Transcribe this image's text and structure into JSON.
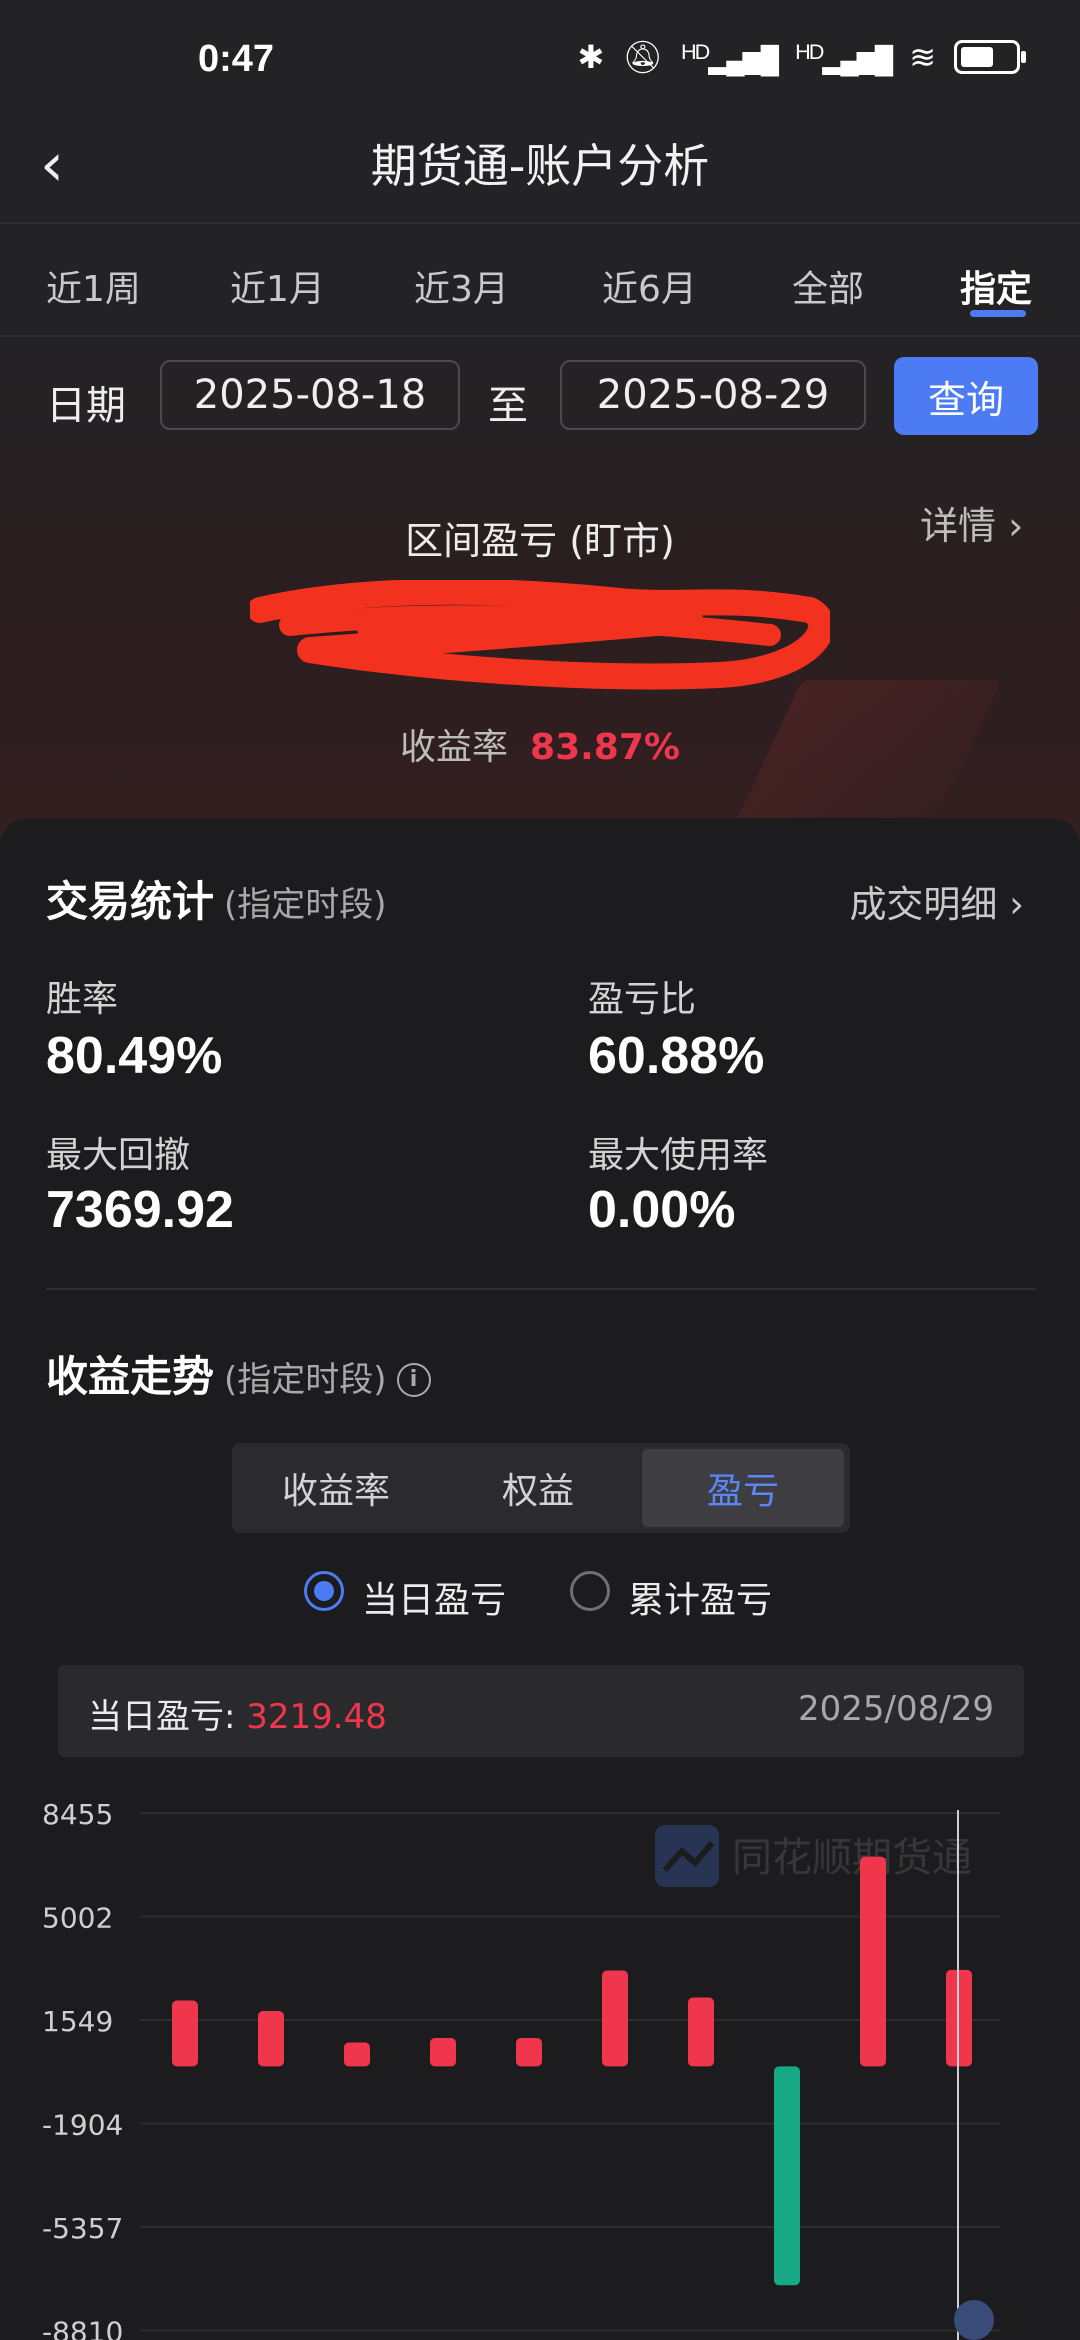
{
  "status_bar": {
    "time": "0:47",
    "hd1": "HD",
    "hd2": "HD"
  },
  "nav": {
    "back": "‹",
    "title": "期货通-账户分析"
  },
  "tabs": [
    "近1周",
    "近1月",
    "近3月",
    "近6月",
    "全部",
    "指定"
  ],
  "active_tab": 5,
  "date_filter": {
    "label": "日期",
    "start": "2025-08-18",
    "separator": "至",
    "end": "2025-08-29",
    "query_label": "查询"
  },
  "summary": {
    "detail_link": "详情 ›",
    "range_title": "区间盈亏 (盯市)",
    "yield_label": "收益率",
    "yield_value": "83.87%"
  },
  "trade_stats": {
    "title": "交易统计",
    "subtitle": "(指定时段)",
    "detail_link": "成交明细 ›",
    "items": [
      {
        "label": "胜率",
        "value": "80.49%"
      },
      {
        "label": "盈亏比",
        "value": "60.88%"
      },
      {
        "label": "最大回撤",
        "value": "7369.92"
      },
      {
        "label": "最大使用率",
        "value": "0.00%"
      }
    ]
  },
  "trend": {
    "title": "收益走势",
    "subtitle": "(指定时段)",
    "info_icon": "i",
    "segments": [
      "收益率",
      "权益",
      "盈亏"
    ],
    "active_segment": 2,
    "radios": [
      {
        "label": "当日盈亏",
        "checked": true
      },
      {
        "label": "累计盈亏",
        "checked": false
      }
    ],
    "daily": {
      "label": "当日盈亏:",
      "value": "3219.48",
      "date": "2025/08/29"
    },
    "watermark": "同花顺期货通"
  },
  "colors": {
    "accent": "#4d7bf3",
    "gain": "#f0364c",
    "loss": "#17a884"
  },
  "chart_data": {
    "type": "bar",
    "y_ticks": [
      8455,
      5002,
      1549,
      -1904,
      -5357,
      -8810
    ],
    "ylim": [
      -8810,
      8455
    ],
    "values": [
      2200,
      1850,
      800,
      950,
      950,
      3200,
      2300,
      -7300,
      7000,
      3219.48
    ],
    "grid": true
  }
}
